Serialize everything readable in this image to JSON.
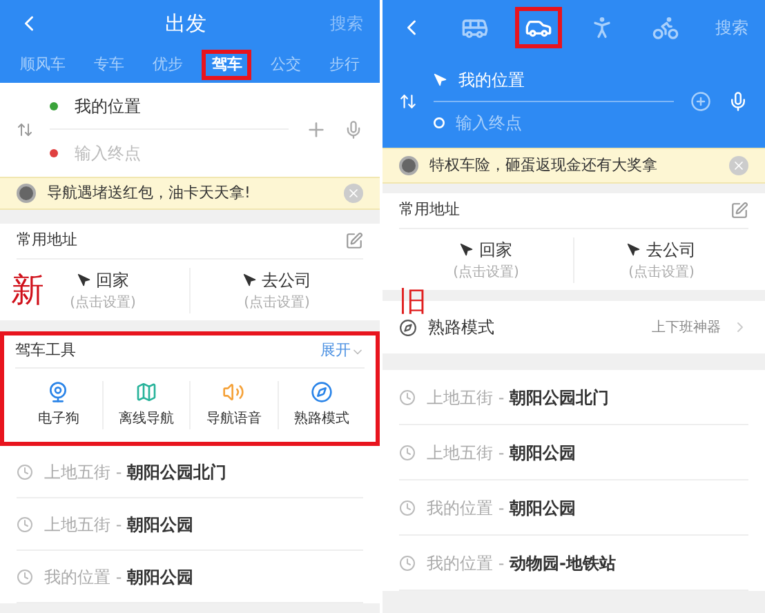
{
  "left": {
    "annotation_label": "新",
    "header": {
      "title": "出发",
      "search": "搜索"
    },
    "tabs": [
      {
        "label": "顺风车",
        "selected": false,
        "annotated": false
      },
      {
        "label": "专车",
        "selected": false,
        "annotated": false
      },
      {
        "label": "优步",
        "selected": false,
        "annotated": false
      },
      {
        "label": "驾车",
        "selected": true,
        "annotated": true
      },
      {
        "label": "公交",
        "selected": false,
        "annotated": false
      },
      {
        "label": "步行",
        "selected": false,
        "annotated": false
      }
    ],
    "route": {
      "start": "我的位置",
      "end_placeholder": "输入终点"
    },
    "banner": "导航遇堵送红包，油卡天天拿!",
    "common_addresses": {
      "title": "常用地址",
      "items": [
        {
          "label": "回家",
          "hint": "(点击设置)"
        },
        {
          "label": "去公司",
          "hint": "(点击设置)"
        }
      ]
    },
    "driving_tools": {
      "title": "驾车工具",
      "expand": "展开",
      "annotated": true,
      "items": [
        {
          "kind": "camera",
          "label": "电子狗"
        },
        {
          "kind": "map",
          "label": "离线导航"
        },
        {
          "kind": "speaker",
          "label": "导航语音"
        },
        {
          "kind": "compass",
          "label": "熟路模式"
        }
      ]
    },
    "history": [
      "上地五街 - **朝阳公园北门**",
      "上地五街 - **朝阳公园**",
      "我的位置 - **朝阳公园**"
    ]
  },
  "right": {
    "annotation_label": "旧",
    "header": {
      "search": "搜索",
      "modes": [
        {
          "kind": "bus",
          "selected": false
        },
        {
          "kind": "car",
          "selected": true
        },
        {
          "kind": "walk",
          "selected": false
        },
        {
          "kind": "bike",
          "selected": false
        }
      ]
    },
    "route": {
      "start": "我的位置",
      "end_placeholder": "输入终点"
    },
    "banner": "特权车险，砸蛋返现金还有大奖拿",
    "common_addresses": {
      "title": "常用地址",
      "items": [
        {
          "label": "回家",
          "hint": "(点击设置)"
        },
        {
          "label": "去公司",
          "hint": "(点击设置)"
        }
      ]
    },
    "familiar_route": {
      "title": "熟路模式",
      "detail": "上下班神器"
    },
    "history": [
      "上地五街 - **朝阳公园北门**",
      "上地五街 - **朝阳公园**",
      "我的位置 - **朝阳公园**",
      "我的位置 - **动物园-地铁站**"
    ]
  }
}
